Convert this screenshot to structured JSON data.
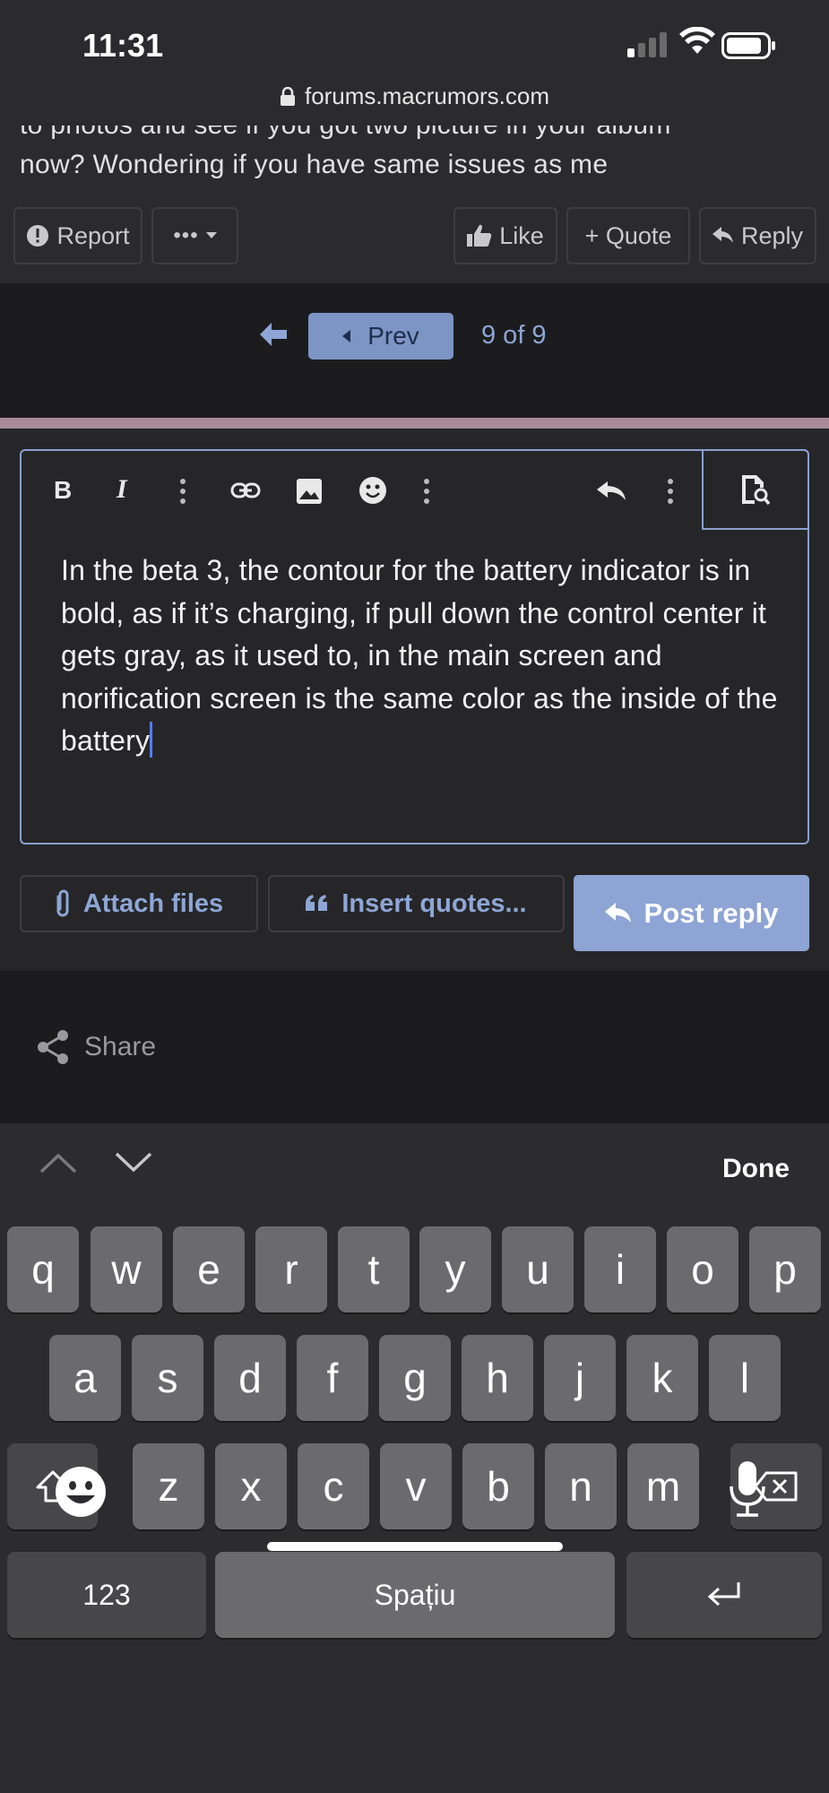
{
  "status_bar": {
    "time": "11:31"
  },
  "browser": {
    "url": "forums.macrumors.com"
  },
  "post": {
    "text_partial_line": "to photos and see if you got two picture in your album",
    "text_line": "now? Wondering if you have same issues as me",
    "actions": {
      "report": "Report",
      "more": "•••",
      "like": "Like",
      "quote": "+ Quote",
      "reply": "Reply"
    }
  },
  "pagination": {
    "prev_label": "Prev",
    "page_status": "9 of 9"
  },
  "editor": {
    "text": "In the beta 3, the contour for the battery indicator is in bold, as if it’s charging, if pull down the control center it gets gray, as it used to, in the main screen and norification screen is the same color as the inside of the battery"
  },
  "editor_actions": {
    "attach_files": "Attach files",
    "insert_quotes": "Insert quotes...",
    "post_reply": "Post reply"
  },
  "share": {
    "label": "Share"
  },
  "keyboard": {
    "done": "Done",
    "row1": [
      "q",
      "w",
      "e",
      "r",
      "t",
      "y",
      "u",
      "i",
      "o",
      "p"
    ],
    "row2": [
      "a",
      "s",
      "d",
      "f",
      "g",
      "h",
      "j",
      "k",
      "l"
    ],
    "row3": [
      "z",
      "x",
      "c",
      "v",
      "b",
      "n",
      "m"
    ],
    "numbers_key": "123",
    "space_key": "Spațiu"
  },
  "colors": {
    "accent": "#8da4d4",
    "link": "#8ea6d6",
    "divider": "#a88a9a",
    "caret": "#4f7ef7"
  }
}
